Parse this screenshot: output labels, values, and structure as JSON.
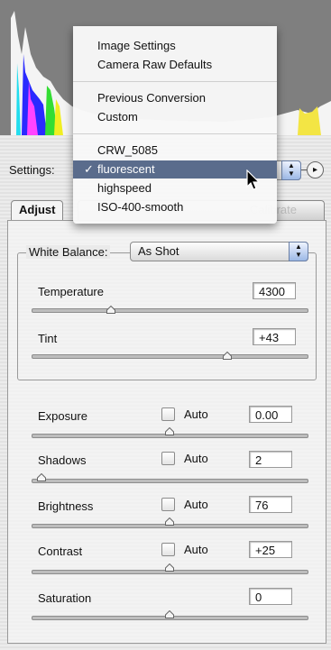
{
  "settings": {
    "label": "Settings:",
    "stepper_up": "▲",
    "stepper_down": "▼",
    "menu_button": "▸"
  },
  "menu": {
    "items": [
      {
        "label": "Image Settings",
        "selected": false
      },
      {
        "label": "Camera Raw Defaults",
        "selected": false
      },
      {
        "label": "Previous Conversion",
        "selected": false
      },
      {
        "label": "Custom",
        "selected": false
      },
      {
        "label": "CRW_5085",
        "selected": false
      },
      {
        "label": "fluorescent",
        "selected": true,
        "check": "✓"
      },
      {
        "label": "highspeed",
        "selected": false
      },
      {
        "label": "ISO-400-smooth",
        "selected": false
      }
    ]
  },
  "tabs": {
    "adjust": "Adjust",
    "other_visible": "Calibrate"
  },
  "white_balance": {
    "label": "White Balance:",
    "value": "As Shot",
    "stepper_up": "▲",
    "stepper_down": "▼"
  },
  "controls": {
    "temperature": {
      "label": "Temperature",
      "value": "4300",
      "slider_pct": 0.28
    },
    "tint": {
      "label": "Tint",
      "value": "+43",
      "slider_pct": 0.72
    },
    "exposure": {
      "label": "Exposure",
      "auto": "Auto",
      "value": "0.00",
      "slider_pct": 0.5
    },
    "shadows": {
      "label": "Shadows",
      "auto": "Auto",
      "value": "2",
      "slider_pct": 0.02
    },
    "brightness": {
      "label": "Brightness",
      "auto": "Auto",
      "value": "76",
      "slider_pct": 0.5
    },
    "contrast": {
      "label": "Contrast",
      "auto": "Auto",
      "value": "+25",
      "slider_pct": 0.5
    },
    "saturation": {
      "label": "Saturation",
      "value": "0",
      "slider_pct": 0.5
    }
  },
  "colors": {
    "menu_highlight": "#5a6c8c",
    "histogram_bg": "#7f7f7f"
  }
}
